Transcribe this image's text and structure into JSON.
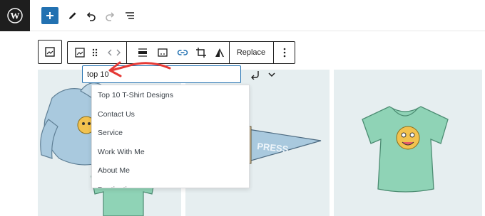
{
  "colors": {
    "accent": "#2271b1",
    "annotation_arrow": "#e53935",
    "panel_bg": "#e6eef0"
  },
  "icons": {
    "logo": "wordpress-logo-icon",
    "add": "plus-icon",
    "tools": "pencil-icon",
    "undo": "undo-icon",
    "redo": "redo-icon",
    "list_view": "list-view-icon"
  },
  "block_toolbar": {
    "replace_label": "Replace",
    "buttons": [
      "image-icon",
      "drag-handle-icon",
      "move-arrows-icon",
      "align-icon",
      "caption-icon",
      "link-icon",
      "crop-icon",
      "filter-icon",
      "more-options-icon"
    ]
  },
  "link_control": {
    "value": "top 10",
    "suggestions": [
      "Top 10 T-Shirt Designs",
      "Contact Us",
      "Service",
      "Work With Me",
      "About Me",
      "Destination"
    ]
  }
}
